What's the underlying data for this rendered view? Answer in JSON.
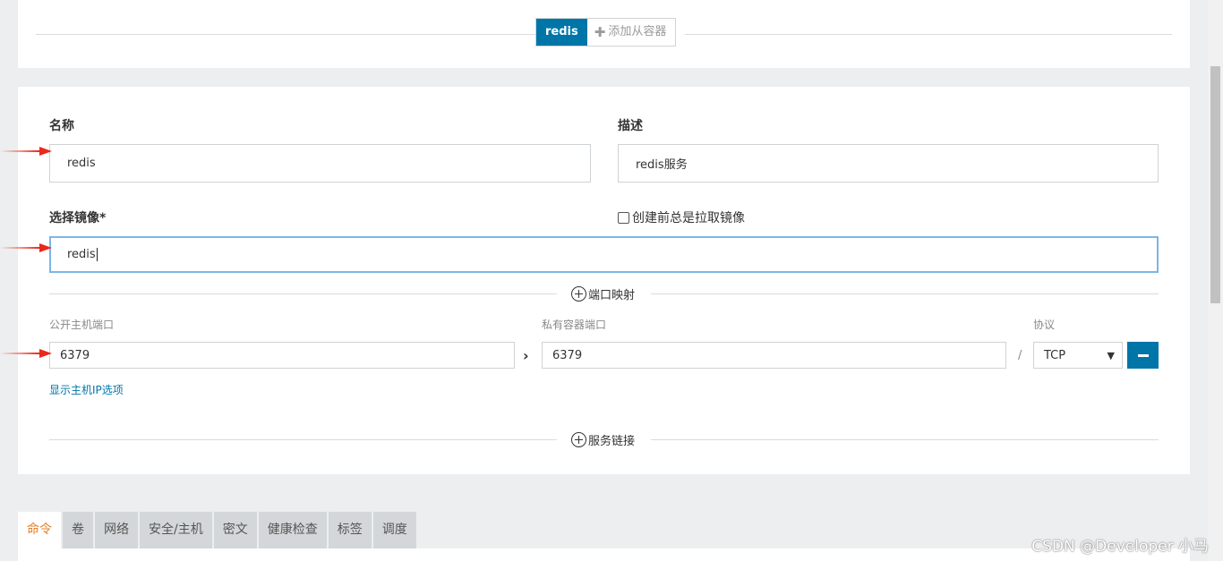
{
  "header": {
    "active_tab": "redis",
    "add_sidecar_label": "添加从容器"
  },
  "form": {
    "name_label": "名称",
    "name_value": "redis",
    "description_label": "描述",
    "description_value": "redis服务",
    "image_label": "选择镜像*",
    "image_value": "redis",
    "always_pull_label": "创建前总是拉取镜像"
  },
  "ports": {
    "section_label": "端口映射",
    "public_port_label": "公开主机端口",
    "public_port_value": "6379",
    "private_port_label": "私有容器端口",
    "private_port_value": "6379",
    "protocol_label": "协议",
    "protocol_value": "TCP",
    "slash": "/",
    "show_host_ip_link": "显示主机IP选项"
  },
  "links": {
    "section_label": "服务链接"
  },
  "bottom_tabs": [
    {
      "label": "命令",
      "active": true
    },
    {
      "label": "卷"
    },
    {
      "label": "网络"
    },
    {
      "label": "安全/主机"
    },
    {
      "label": "密文"
    },
    {
      "label": "健康检查"
    },
    {
      "label": "标签"
    },
    {
      "label": "调度"
    }
  ],
  "watermark": "CSDN @Developer 小马",
  "colors": {
    "accent": "#0075a8",
    "active_tab_text": "#e67e22",
    "arrow": "#e8291c"
  }
}
